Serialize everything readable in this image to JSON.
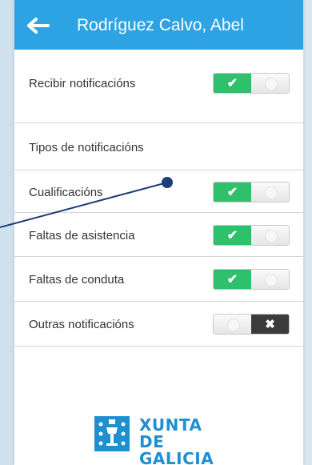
{
  "header": {
    "title": "Rodríguez Calvo, Abel",
    "back_icon": "arrow-left-icon",
    "color": "#2ea3e3"
  },
  "settings": {
    "receive": {
      "label": "Recibir notificacións",
      "enabled": true
    },
    "section_title": "Tipos de notificacións",
    "types": [
      {
        "label": "Cualificacións",
        "enabled": true
      },
      {
        "label": "Faltas de asistencia",
        "enabled": true
      },
      {
        "label": "Faltas de conduta",
        "enabled": true
      },
      {
        "label": "Outras notificacións",
        "enabled": false
      }
    ]
  },
  "toggle": {
    "on_icon": "check-icon",
    "off_icon": "x-icon",
    "on_color": "#2ec06a",
    "off_color": "#3b3b3b"
  },
  "footer": {
    "logo_line1": "XUNTA",
    "logo_line2": "DE GALICIA",
    "logo_icon": "xunta-shield-icon"
  }
}
